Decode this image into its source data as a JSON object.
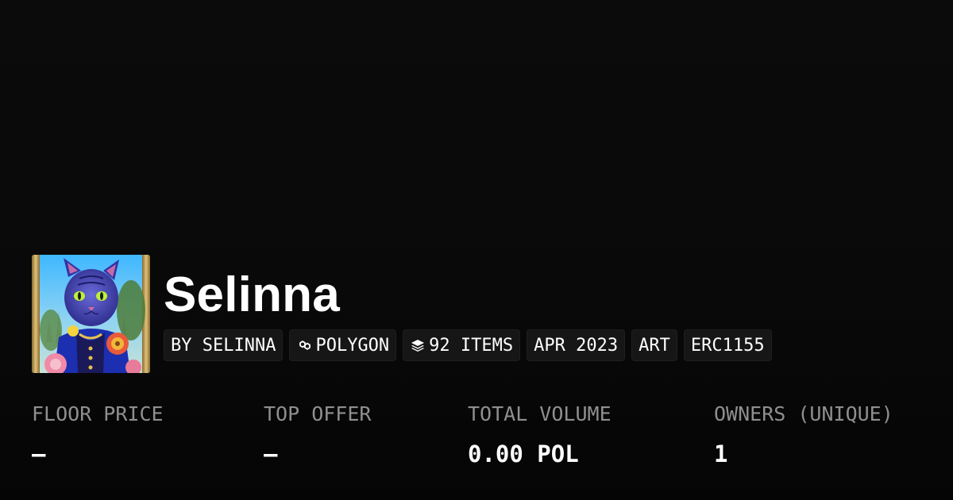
{
  "collection": {
    "name": "Selinna",
    "avatar_alt": "blue cat portrait",
    "tags": [
      {
        "label": "BY SELINNA",
        "icon": null
      },
      {
        "label": "POLYGON",
        "icon": "polygon-icon"
      },
      {
        "label": "92 ITEMS",
        "icon": "layers-icon"
      },
      {
        "label": "APR 2023",
        "icon": null
      },
      {
        "label": "ART",
        "icon": null
      },
      {
        "label": "ERC1155",
        "icon": null
      }
    ]
  },
  "stats": [
    {
      "label": "FLOOR PRICE",
      "value": "–"
    },
    {
      "label": "TOP OFFER",
      "value": "–"
    },
    {
      "label": "TOTAL VOLUME",
      "value": "0.00 POL"
    },
    {
      "label": "OWNERS (UNIQUE)",
      "value": "1"
    }
  ],
  "colors": {
    "background": "#0a0a0a",
    "chip_background": "#161616",
    "label_gray": "#8f8f8f",
    "text": "#ffffff"
  }
}
